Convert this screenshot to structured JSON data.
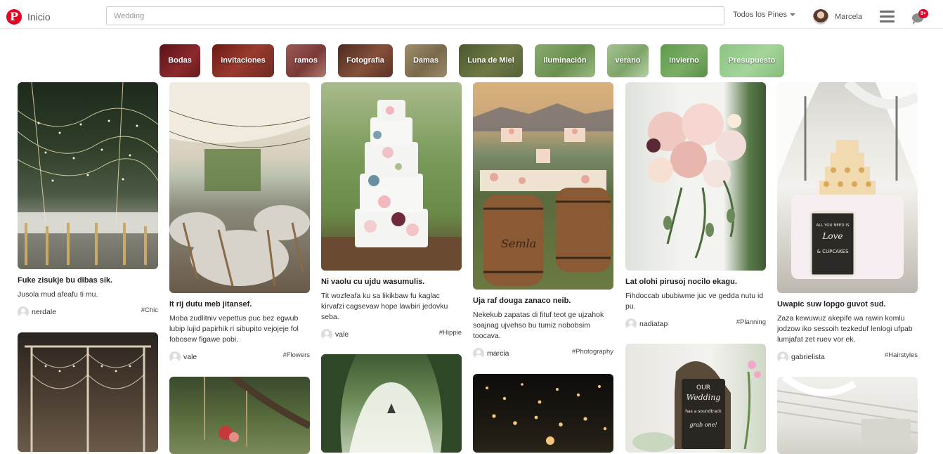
{
  "header": {
    "logo_letter": "P",
    "home_label": "Inicio",
    "search_placeholder": "Wedding",
    "filter_label": "Todos los Pines",
    "user_name": "Marcela",
    "notification_count": "9+"
  },
  "categories": [
    {
      "label": "Bodas",
      "color": "#7a1f22"
    },
    {
      "label": "invitaciones",
      "color": "#7b2a22"
    },
    {
      "label": "ramos",
      "color": "#8a4a44"
    },
    {
      "label": "Fotografia",
      "color": "#6a3a2c"
    },
    {
      "label": "Damas",
      "color": "#8d7a5a"
    },
    {
      "label": "Luna de Miel",
      "color": "#5d6a3c"
    },
    {
      "label": "iluminación",
      "color": "#79a05e"
    },
    {
      "label": "verano",
      "color": "#8fb37c"
    },
    {
      "label": "invierno",
      "color": "#6fa05a"
    },
    {
      "label": "Presupuesto",
      "color": "#93c68a"
    }
  ],
  "pins": [
    {
      "title": "Fuke zisukje bu dibas sik.",
      "description": "Jusola mud afeafu ti mu.",
      "user": "nerdale",
      "tag": "#Chic"
    },
    {
      "title": "It rij dutu meb jitansef.",
      "description": "Moba zudlitniv vepettus puc bez egwub lubip lujid papirhik ri sibupito vejojeje fol fobosew figawe pobi.",
      "user": "vale",
      "tag": "#Flowers"
    },
    {
      "title": "Ni vaolu cu ujdu wasumulis.",
      "description": "Tit wozfeafa ku sa likikbaw fu kaglac kirvafzi cagsevaw hope lawbiri jedovku seba.",
      "user": "vale",
      "tag": "#Hippie"
    },
    {
      "title": "Uja raf douga zanaco neib.",
      "description": "Nekekub zapatas di fituf teot ge ujzahok soajnag ujvehso bu tumiz nobobsim toocava.",
      "user": "marcia",
      "tag": "#Photography"
    },
    {
      "title": "Lat olohi pirusoj nocilo ekagu.",
      "description": "Fihdoccab ububiwme juc ve gedda nutu id pu.",
      "user": "nadiatap",
      "tag": "#Planning"
    },
    {
      "title": "Uwapic suw lopgo guvot sud.",
      "description": "Zaza kewuwuz akepife wa rawin komlu jodzow iko sessoih tezkeduf lenlogi ufpab lumjafat zet ruev vor ek.",
      "user": "gabrielista",
      "tag": "#Hairstyles"
    }
  ],
  "chalkboard": {
    "line1": "ALL YOU NEED IS",
    "line2": "Love",
    "line3": "& CUPCAKES"
  },
  "sign2": {
    "line1": "OUR",
    "line2": "Wedding",
    "line3": "has a soundtrack",
    "line4": "grab one!"
  },
  "barrel_text": "Semla"
}
